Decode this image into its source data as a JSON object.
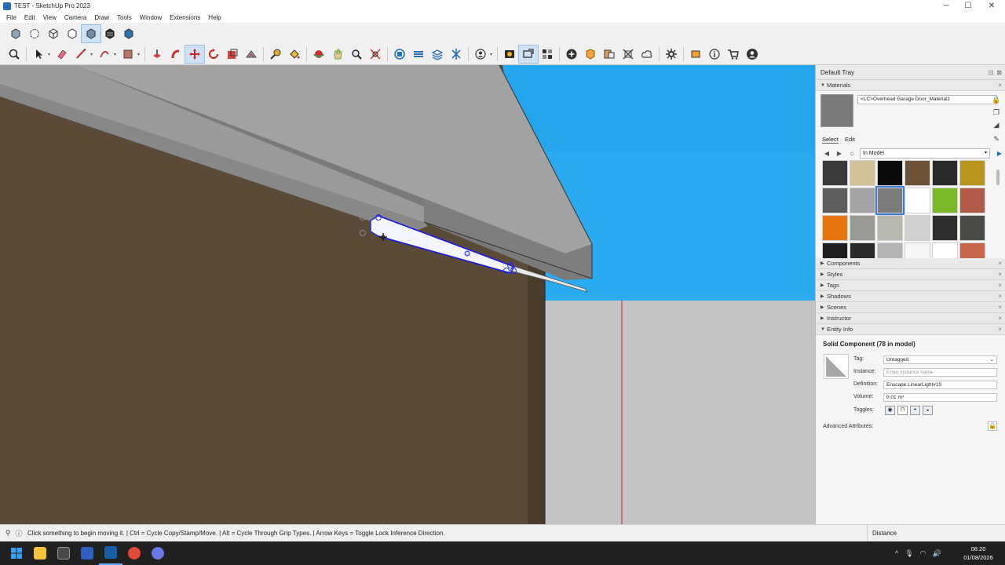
{
  "window": {
    "title": "TEST - SketchUp Pro 2023",
    "minimize": "─",
    "maximize": "☐",
    "close": "✕"
  },
  "menu": [
    "File",
    "Edit",
    "View",
    "Camera",
    "Draw",
    "Tools",
    "Window",
    "Extensions",
    "Help"
  ],
  "toolbar_top": [
    "xray-style-icon",
    "back-edges-icon",
    "wireframe-icon",
    "hidden-line-icon",
    "shaded-icon",
    "shaded-textures-icon",
    "monochrome-icon"
  ],
  "tray": {
    "title": "Default Tray",
    "materials": {
      "panel_title": "Materials",
      "current_name": "<LC>Overhead Garage Door_Material1",
      "tab_select": "Select",
      "tab_edit": "Edit",
      "collection": "In Model",
      "swatch_colors": [
        "#3a3a3a",
        "#d2c29a",
        "#0a0a0a",
        "#6e5236",
        "#2b2b2b",
        "#b8941e",
        "#5e5e5e",
        "#a4a4a4",
        "#7c7c7c",
        "#ffffff",
        "#7ab82a",
        "#b05a48",
        "#e8760e",
        "#9a9a94",
        "#b8b8b0",
        "#d0d0d0",
        "#2e2e2e",
        "#4a4a46",
        "#1e1e1e",
        "#2a2a2a",
        "#b4b4b4",
        "#f6f6f6",
        "#ffffff",
        "#c8664a"
      ],
      "selected_swatch_index": 8
    },
    "panels": [
      "Components",
      "Styles",
      "Tags",
      "Shadows",
      "Scenes",
      "Instructor"
    ],
    "entity_info": {
      "panel_title": "Entity Info",
      "heading": "Solid Component (78 in model)",
      "tag_label": "Tag:",
      "tag_value": "Untagged",
      "instance_label": "Instance:",
      "instance_placeholder": "Enter instance name",
      "definition_label": "Definition:",
      "definition_value": "Enscape.LinearLight#10",
      "volume_label": "Volume:",
      "volume_value": "0.01 m³",
      "toggles_label": "Toggles:",
      "advanced_label": "Advanced Attributes:"
    }
  },
  "status": {
    "message": "Click something to begin moving it. | Ctrl = Cycle Copy/Stamp/Move. | Alt = Cycle Through Grip Types. | Arrow Keys = Toggle Lock Inference Direction.",
    "measurement_label": "Distance"
  },
  "taskbar": {
    "time": "08:20",
    "date": "01/08/2026"
  }
}
